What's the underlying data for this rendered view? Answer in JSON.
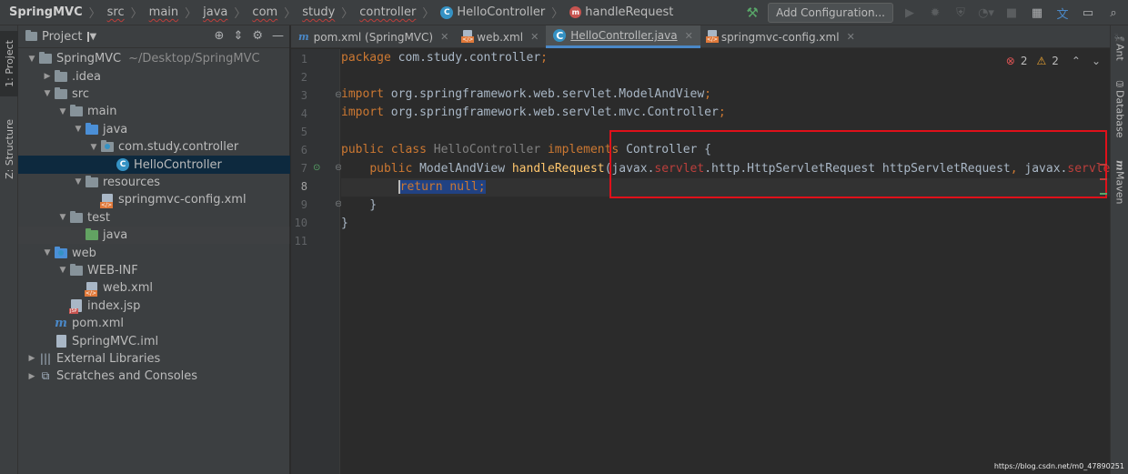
{
  "breadcrumbs": [
    {
      "label": "SpringMVC",
      "kind": "root"
    },
    {
      "label": "src",
      "kind": "squiggle"
    },
    {
      "label": "main",
      "kind": "squiggle"
    },
    {
      "label": "java",
      "kind": "squiggle"
    },
    {
      "label": "com",
      "kind": "squiggle"
    },
    {
      "label": "study",
      "kind": "squiggle"
    },
    {
      "label": "controller",
      "kind": "squiggle"
    },
    {
      "label": "HelloController",
      "kind": "class"
    },
    {
      "label": "handleRequest",
      "kind": "method"
    }
  ],
  "toolbar": {
    "add_configuration": "Add Configuration...",
    "icons": [
      "build-icon",
      "run-icon",
      "debug-icon",
      "coverage-icon",
      "profile-icon",
      "stop-icon",
      "project-structure-icon",
      "translate-icon",
      "layout-icon",
      "search-icon"
    ]
  },
  "left_tools": {
    "project": "1: Project",
    "structure": "Z: Structure"
  },
  "project_panel": {
    "title": "Project",
    "tree": [
      {
        "label": "SpringMVC",
        "suffix": "~/Desktop/SpringMVC",
        "depth": 0,
        "arrow": "down",
        "icon": "folder"
      },
      {
        "label": ".idea",
        "depth": 1,
        "arrow": "right",
        "icon": "folder"
      },
      {
        "label": "src",
        "depth": 1,
        "arrow": "down",
        "icon": "folder"
      },
      {
        "label": "main",
        "depth": 2,
        "arrow": "down",
        "icon": "folder"
      },
      {
        "label": "java",
        "depth": 3,
        "arrow": "down",
        "icon": "folder-blue"
      },
      {
        "label": "com.study.controller",
        "depth": 4,
        "arrow": "down",
        "icon": "package"
      },
      {
        "label": "HelloController",
        "depth": 5,
        "arrow": "",
        "icon": "class",
        "selected": true
      },
      {
        "label": "resources",
        "depth": 3,
        "arrow": "down",
        "icon": "folder"
      },
      {
        "label": "springmvc-config.xml",
        "depth": 4,
        "arrow": "",
        "icon": "xml"
      },
      {
        "label": "test",
        "depth": 2,
        "arrow": "down",
        "icon": "folder"
      },
      {
        "label": "java",
        "depth": 3,
        "arrow": "",
        "icon": "folder-green",
        "highlight": true
      },
      {
        "label": "web",
        "depth": 1,
        "arrow": "down",
        "icon": "folder-dot"
      },
      {
        "label": "WEB-INF",
        "depth": 2,
        "arrow": "down",
        "icon": "folder"
      },
      {
        "label": "web.xml",
        "depth": 3,
        "arrow": "",
        "icon": "xml"
      },
      {
        "label": "index.jsp",
        "depth": 2,
        "arrow": "",
        "icon": "jsp"
      },
      {
        "label": "pom.xml",
        "depth": 1,
        "arrow": "",
        "icon": "maven"
      },
      {
        "label": "SpringMVC.iml",
        "depth": 1,
        "arrow": "",
        "icon": "iml"
      },
      {
        "label": "External Libraries",
        "depth": 0,
        "arrow": "right",
        "icon": "libs"
      },
      {
        "label": "Scratches and Consoles",
        "depth": 0,
        "arrow": "right",
        "icon": "scratches"
      }
    ]
  },
  "tabs": [
    {
      "label": "pom.xml (SpringMVC)",
      "icon": "maven",
      "active": false
    },
    {
      "label": "web.xml",
      "icon": "xml",
      "active": false
    },
    {
      "label": "HelloController.java",
      "icon": "class",
      "active": true
    },
    {
      "label": "springmvc-config.xml",
      "icon": "xml",
      "active": false
    }
  ],
  "editor": {
    "line_numbers": [
      "1",
      "2",
      "3",
      "4",
      "5",
      "6",
      "7",
      "8",
      "9",
      "10",
      "11"
    ],
    "current_line": "8",
    "errors_count": "2",
    "warnings_count": "2",
    "code": {
      "l1_kw": "package",
      "l1_rest": " com.study.controller",
      "l1_semi": ";",
      "l3_kw": "import",
      "l3_rest": " org.springframework.web.servlet.ModelAndView",
      "l3_semi": ";",
      "l4_kw": "import",
      "l4_rest": " org.springframework.web.servlet.mvc.Controller",
      "l4_semi": ";",
      "l6_kw1": "public class",
      "l6_name": " HelloController ",
      "l6_kw2": "implements",
      "l6_rest": " Controller {",
      "l7_indent": "    ",
      "l7_kw": "public",
      "l7_type": " ModelAndView ",
      "l7_fn": "handleRequest",
      "l7_p1": "(javax.",
      "l7_err1": "servlet",
      "l7_p2": ".http.HttpServletRequest httpServletRequest",
      "l7_comma": ", ",
      "l7_p3": "javax.",
      "l7_err2": "servle",
      "l8_indent": "        ",
      "l8_code": "return null;",
      "l9": "    }",
      "l10": "}"
    }
  },
  "right_tools": {
    "ant": "Ant",
    "database": "Database",
    "maven": "Maven"
  },
  "watermark": "https://blog.csdn.net/m0_47890251",
  "colors": {
    "keyword": "#cc7832",
    "method": "#ffc66d",
    "error": "#bc3f3c",
    "selection": "#214283",
    "annotation_box": "#e0101a"
  }
}
